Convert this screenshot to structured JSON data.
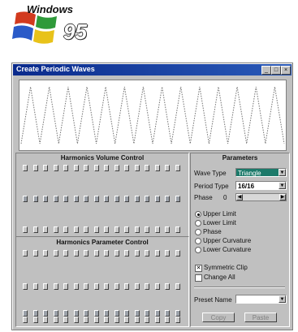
{
  "logo": {
    "word": "Windows",
    "version": "95",
    "flag_colors": [
      "#d23a1e",
      "#2f9a3a",
      "#2a5ac8",
      "#e8c21a"
    ]
  },
  "window": {
    "title": "Create Periodic Waves",
    "buttons": {
      "minimize": "_",
      "maximize": "□",
      "close": "×"
    }
  },
  "harmonics_volume": {
    "title": "Harmonics Volume Control",
    "slider_levels": [
      0.5,
      0.5,
      0.5,
      0.5,
      0.5,
      0.5,
      0.5,
      0.5,
      0.5,
      0.5,
      0.5,
      0.5,
      0.5,
      0.5,
      0.5,
      0.5
    ]
  },
  "harmonics_parameter": {
    "title": "Harmonics Parameter Control",
    "slider_levels": [
      0.1,
      0.1,
      0.1,
      0.1,
      0.1,
      0.1,
      0.1,
      0.1,
      0.1,
      0.1,
      0.1,
      0.1,
      0.1,
      0.1,
      0.1,
      0.1
    ]
  },
  "parameters": {
    "title": "Parameters",
    "wave_type_label": "Wave Type",
    "wave_type_value": "Triangle",
    "period_type_label": "Period Type",
    "period_type_value": "16/16",
    "phase_label": "Phase",
    "phase_value": "0",
    "radio_options": [
      {
        "label": "Upper Limit",
        "checked": true
      },
      {
        "label": "Lower Limit",
        "checked": false
      },
      {
        "label": "Phase",
        "checked": false
      },
      {
        "label": "Upper Curvature",
        "checked": false
      },
      {
        "label": "Lower Curvature",
        "checked": false
      }
    ],
    "symmetric_clip_label": "Symmetric Clip",
    "symmetric_clip_checked": true,
    "change_all_label": "Change All",
    "change_all_checked": false,
    "preset_name_label": "Preset Name",
    "preset_name_value": "",
    "copy_label": "Copy",
    "paste_label": "Paste"
  },
  "colors": {
    "wave": "#707070",
    "selected": "#1c7a6a",
    "titlebar": "#0a2a8c"
  }
}
